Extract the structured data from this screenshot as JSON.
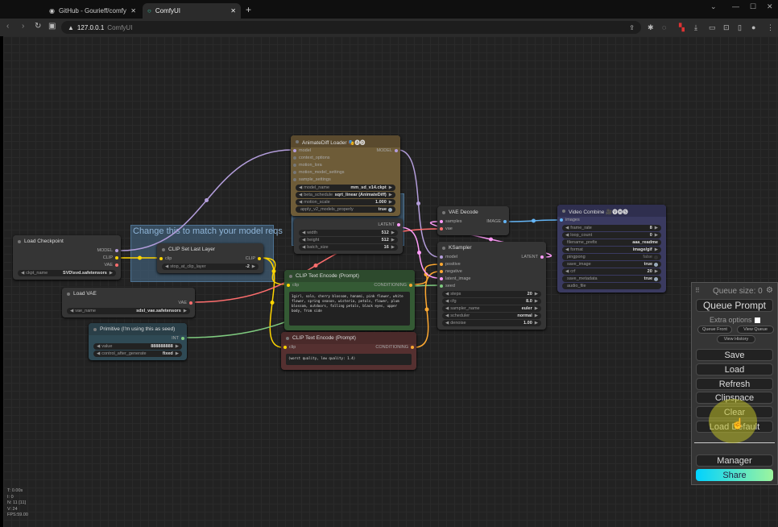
{
  "browser": {
    "tabs": [
      {
        "label": "GitHub - Gourieff/comfyui",
        "icon": "github-icon",
        "active": false
      },
      {
        "label": "ComfyUI",
        "icon": "comfy-icon",
        "active": true
      }
    ],
    "url_host": "127.0.0.1",
    "url_title": "ComfyUI"
  },
  "slot_colors": {
    "MODEL": "#b39ddb",
    "CLIP": "#ffd500",
    "VAE": "#ff6e6e",
    "LATENT": "#ff9cf9",
    "CONDITIONING": "#ffa931",
    "IMAGE": "#64b5f6",
    "INT": "#7fca7f",
    "OTHER": "#777777"
  },
  "groups": [
    {
      "id": "g1",
      "title": "Change this to match your model reqs"
    },
    {
      "id": "g2",
      "title": ""
    }
  ],
  "nodes": [
    {
      "id": "ckpt",
      "title": "Load Checkpoint",
      "inputs": [],
      "outputs": [
        {
          "name": "MODEL",
          "type": "MODEL"
        },
        {
          "name": "CLIP",
          "type": "CLIP"
        },
        {
          "name": "VAE",
          "type": "VAE"
        }
      ],
      "widgets": [
        {
          "name": "ckpt_name",
          "value": "SVD\\svd.safetensors",
          "arrows": true
        }
      ]
    },
    {
      "id": "cliplast",
      "title": "CLIP Set Last Layer",
      "inputs": [
        {
          "name": "clip",
          "type": "CLIP"
        }
      ],
      "outputs": [
        {
          "name": "CLIP",
          "type": "CLIP"
        }
      ],
      "widgets": [
        {
          "name": "stop_at_clip_layer",
          "value": "-2",
          "arrows": true
        }
      ]
    },
    {
      "id": "vae",
      "title": "Load VAE",
      "inputs": [],
      "outputs": [
        {
          "name": "VAE",
          "type": "VAE"
        }
      ],
      "widgets": [
        {
          "name": "vae_name",
          "value": "sdxl_vae.safetensors",
          "arrows": true
        }
      ]
    },
    {
      "id": "prim",
      "title": "Primitive (I'm using this as seed)",
      "inputs": [],
      "outputs": [
        {
          "name": "INT",
          "type": "INT"
        }
      ],
      "widgets": [
        {
          "name": "value",
          "value": "888888888",
          "arrows": true
        },
        {
          "name": "control_after_generate",
          "value": "fixed",
          "arrows": true
        }
      ]
    },
    {
      "id": "latent",
      "title": "",
      "inputs": [],
      "outputs": [
        {
          "name": "LATENT",
          "type": "LATENT"
        }
      ],
      "widgets": [
        {
          "name": "width",
          "value": "512",
          "arrows": true
        },
        {
          "name": "height",
          "value": "512",
          "arrows": true
        },
        {
          "name": "batch_size",
          "value": "16",
          "arrows": true
        }
      ]
    },
    {
      "id": "animdiff",
      "title": "AnimateDiff Loader 🎭🅐🅓",
      "inputs": [
        {
          "name": "model",
          "type": "MODEL"
        },
        {
          "name": "context_options",
          "type": "OTHER"
        },
        {
          "name": "motion_lora",
          "type": "OTHER"
        },
        {
          "name": "motion_model_settings",
          "type": "OTHER"
        },
        {
          "name": "sample_settings",
          "type": "OTHER"
        }
      ],
      "outputs": [
        {
          "name": "MODEL",
          "type": "MODEL"
        }
      ],
      "widgets": [
        {
          "name": "model_name",
          "value": "mm_sd_v14.ckpt",
          "arrows": true
        },
        {
          "name": "beta_schedule",
          "value": "sqrt_linear (AnimateDiff)",
          "arrows": true
        },
        {
          "name": "motion_scale",
          "value": "1.000",
          "arrows": true
        },
        {
          "name": "apply_v2_models_properly",
          "value": "true",
          "toggle": true
        }
      ]
    },
    {
      "id": "pos",
      "title": "CLIP Text Encode (Prompt)",
      "inputs": [
        {
          "name": "clip",
          "type": "CLIP"
        }
      ],
      "outputs": [
        {
          "name": "CONDITIONING",
          "type": "CONDITIONING"
        }
      ],
      "widgets": [],
      "text": "1girl, solo, cherry blossom, hanami, pink flower, white flower, spring season, wisteria, petals, flower, plum blossom, outdoors, falling petals, black eyes, upper body, from side"
    },
    {
      "id": "neg",
      "title": "CLIP Text Encode (Prompt)",
      "inputs": [
        {
          "name": "clip",
          "type": "CLIP"
        }
      ],
      "outputs": [
        {
          "name": "CONDITIONING",
          "type": "CONDITIONING"
        }
      ],
      "widgets": [],
      "text": "(worst quality, low quality: 1.4)"
    },
    {
      "id": "vaedec",
      "title": "VAE Decode",
      "inputs": [
        {
          "name": "samples",
          "type": "LATENT"
        },
        {
          "name": "vae",
          "type": "VAE"
        }
      ],
      "outputs": [
        {
          "name": "IMAGE",
          "type": "IMAGE"
        }
      ],
      "widgets": []
    },
    {
      "id": "ksampler",
      "title": "KSampler",
      "inputs": [
        {
          "name": "model",
          "type": "MODEL"
        },
        {
          "name": "positive",
          "type": "CONDITIONING"
        },
        {
          "name": "negative",
          "type": "CONDITIONING"
        },
        {
          "name": "latent_image",
          "type": "LATENT"
        },
        {
          "name": "seed",
          "type": "INT"
        }
      ],
      "outputs": [
        {
          "name": "LATENT",
          "type": "LATENT"
        }
      ],
      "widgets": [
        {
          "name": "steps",
          "value": "20",
          "arrows": true
        },
        {
          "name": "cfg",
          "value": "8.0",
          "arrows": true
        },
        {
          "name": "sampler_name",
          "value": "euler",
          "arrows": true
        },
        {
          "name": "scheduler",
          "value": "normal",
          "arrows": true
        },
        {
          "name": "denoise",
          "value": "1.00",
          "arrows": true
        }
      ]
    },
    {
      "id": "video",
      "title": "Video Combine 🎥🅥🅗🅢",
      "inputs": [
        {
          "name": "images",
          "type": "IMAGE"
        }
      ],
      "outputs": [],
      "widgets": [
        {
          "name": "frame_rate",
          "value": "8",
          "arrows": true
        },
        {
          "name": "loop_count",
          "value": "0",
          "arrows": true
        },
        {
          "name": "filename_prefix",
          "value": "aaa_readme"
        },
        {
          "name": "format",
          "value": "image/gif",
          "arrows": true
        },
        {
          "name": "pingpong",
          "value": "false",
          "toggle": true,
          "off": true
        },
        {
          "name": "save_image",
          "value": "true",
          "toggle": true
        },
        {
          "name": "crf",
          "value": "20",
          "arrows": true
        },
        {
          "name": "save_metadata",
          "value": "true",
          "toggle": true
        },
        {
          "name": "audio_file",
          "value": ""
        }
      ]
    }
  ],
  "panel": {
    "queue_size": "Queue size: 0",
    "queue_prompt": "Queue Prompt",
    "extra_options": "Extra options",
    "queue_front": "Queue Front",
    "view_queue": "View Queue",
    "view_history": "View History",
    "save": "Save",
    "load": "Load",
    "refresh": "Refresh",
    "clipspace": "Clipspace",
    "clear": "Clear",
    "load_default": "Load Default",
    "manager": "Manager",
    "share": "Share"
  },
  "stats": [
    "T: 0.00s",
    "I: 0",
    "N: 11 [11]",
    "V: 24",
    "FPS:59.00"
  ]
}
